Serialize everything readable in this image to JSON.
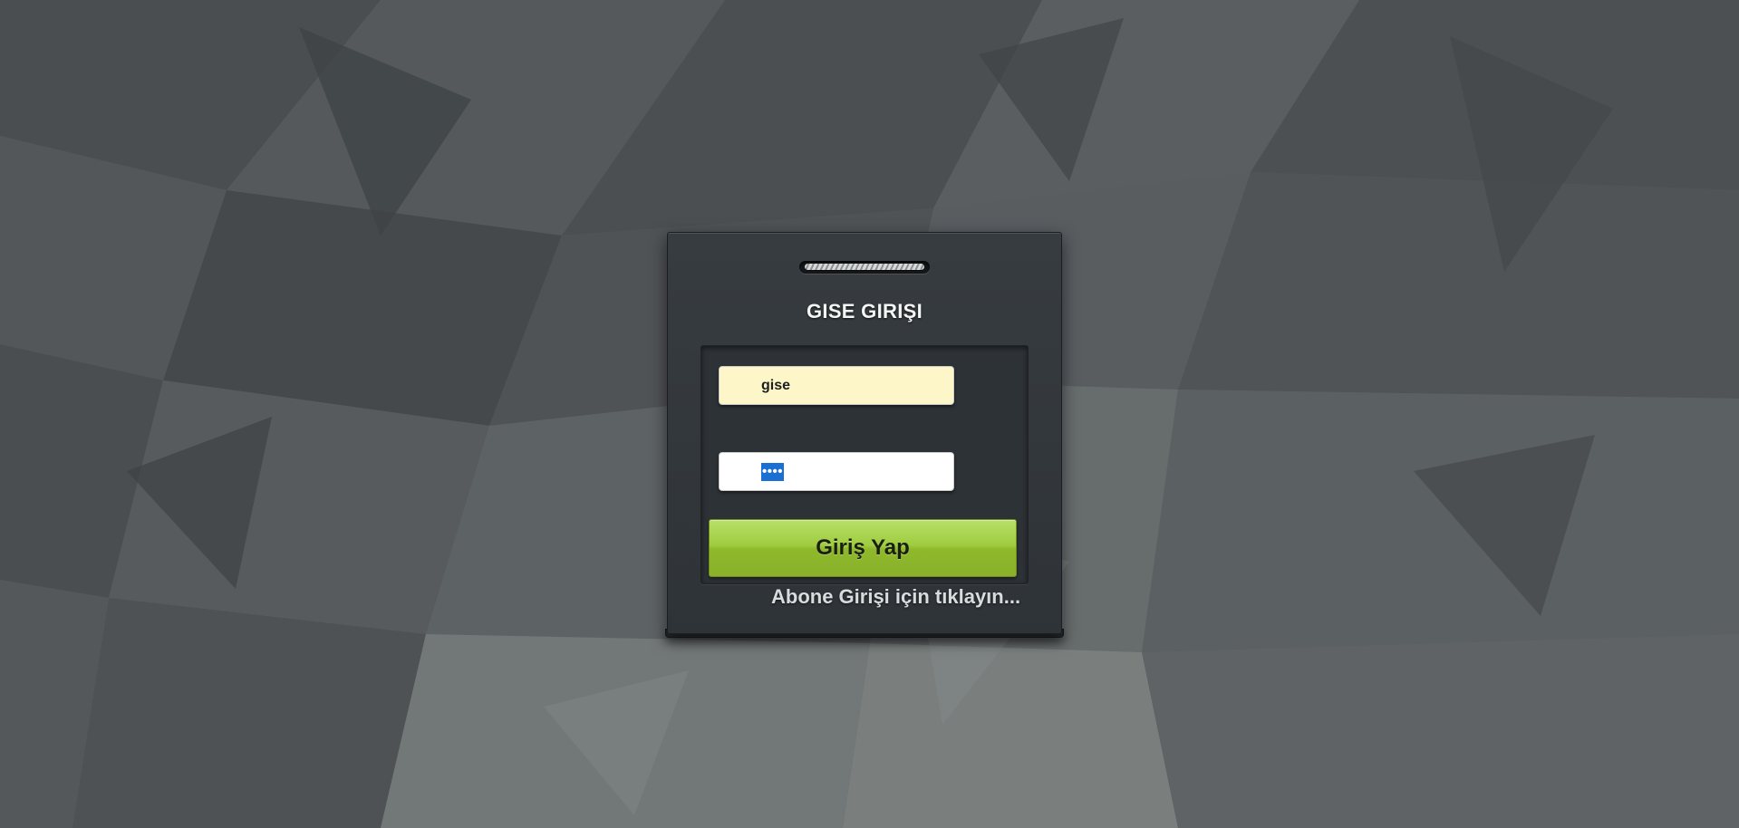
{
  "login": {
    "title": "GISE GIRIŞI",
    "username_value": "gise",
    "password_masked": "••••",
    "submit_label": "Giriş Yap",
    "subscriber_link": "Abone Girişi için tıklayın..."
  },
  "colors": {
    "card": "#33383c",
    "username_field": "#fdf6c9",
    "password_field": "#ffffff",
    "button_green": "#9fcc3f",
    "selection_blue": "#1a6fd3"
  }
}
